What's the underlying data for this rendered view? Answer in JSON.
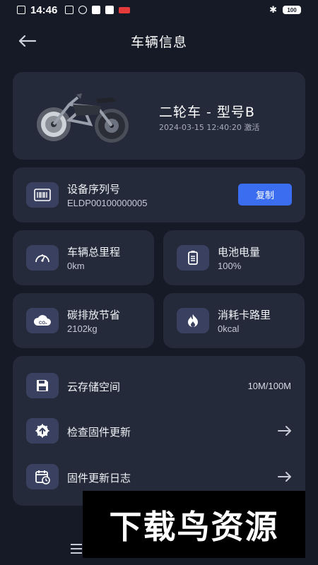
{
  "status_bar": {
    "time": "14:46",
    "battery": "100"
  },
  "header": {
    "title": "车辆信息"
  },
  "vehicle": {
    "name": "二轮车 - 型号B",
    "activation": "2024-03-15 12:40:20 激活"
  },
  "serial": {
    "label": "设备序列号",
    "value": "ELDP00100000005",
    "copy_label": "复制"
  },
  "stats": {
    "mileage": {
      "label": "车辆总里程",
      "value": "0km"
    },
    "battery": {
      "label": "电池电量",
      "value": "100%"
    },
    "carbon": {
      "label": "碳排放节省",
      "value": "2102kg"
    },
    "calories": {
      "label": "消耗卡路里",
      "value": "0kcal"
    }
  },
  "settings": {
    "storage": {
      "label": "云存储空间",
      "value": "10M/100M"
    },
    "firmware_check": {
      "label": "检查固件更新"
    },
    "firmware_log": {
      "label": "固件更新日志"
    }
  },
  "watermark": {
    "text": "下载鸟资源"
  },
  "colors": {
    "background": "#161a27",
    "card": "#252a3b",
    "icon_box": "#3a4160",
    "accent": "#3b6df0"
  }
}
